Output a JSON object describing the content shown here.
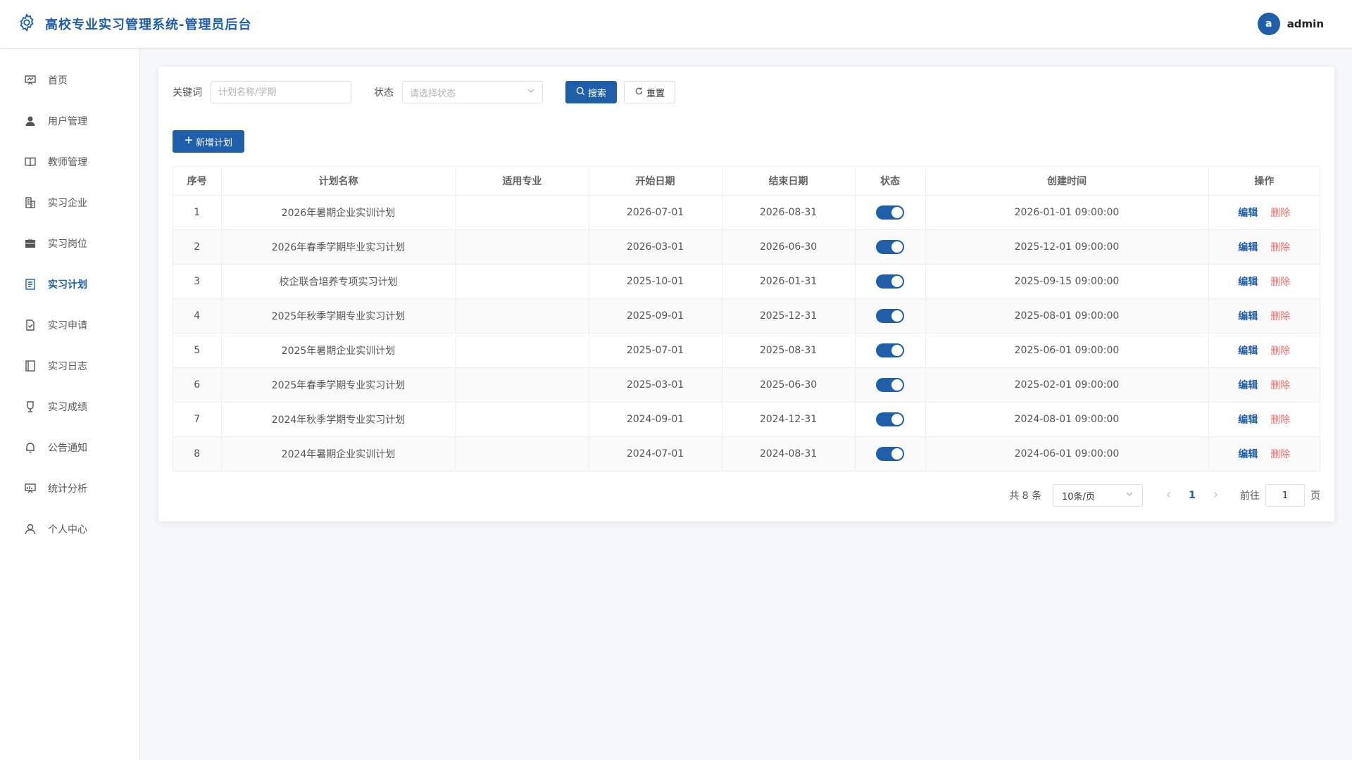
{
  "header": {
    "title": "高校专业实习管理系统-管理员后台",
    "avatar_letter": "a",
    "username": "admin"
  },
  "sidebar": {
    "items": [
      {
        "label": "首页",
        "icon": "dashboard-icon"
      },
      {
        "label": "用户管理",
        "icon": "user-icon"
      },
      {
        "label": "教师管理",
        "icon": "book-icon"
      },
      {
        "label": "实习企业",
        "icon": "building-icon"
      },
      {
        "label": "实习岗位",
        "icon": "briefcase-icon"
      },
      {
        "label": "实习计划",
        "icon": "document-icon",
        "active": true
      },
      {
        "label": "实习申请",
        "icon": "check-document-icon"
      },
      {
        "label": "实习日志",
        "icon": "notebook-icon"
      },
      {
        "label": "实习成绩",
        "icon": "trophy-icon"
      },
      {
        "label": "公告通知",
        "icon": "bell-icon"
      },
      {
        "label": "统计分析",
        "icon": "chart-board-icon"
      },
      {
        "label": "个人中心",
        "icon": "person-icon"
      }
    ]
  },
  "filters": {
    "keyword_label": "关键词",
    "keyword_placeholder": "计划名称/学期",
    "keyword_value": "",
    "status_label": "状态",
    "status_placeholder": "请选择状态",
    "search_label": "搜索",
    "reset_label": "重置"
  },
  "add_button_label": "新增计划",
  "table": {
    "columns": [
      "序号",
      "计划名称",
      "适用专业",
      "开始日期",
      "结束日期",
      "状态",
      "创建时间",
      "操作"
    ],
    "rows": [
      {
        "index": "1",
        "name": "2026年暑期企业实训计划",
        "major": "",
        "start": "2026-07-01",
        "end": "2026-08-31",
        "enabled": true,
        "created": "2026-01-01 09:00:00"
      },
      {
        "index": "2",
        "name": "2026年春季学期毕业实习计划",
        "major": "",
        "start": "2026-03-01",
        "end": "2026-06-30",
        "enabled": true,
        "created": "2025-12-01 09:00:00"
      },
      {
        "index": "3",
        "name": "校企联合培养专项实习计划",
        "major": "",
        "start": "2025-10-01",
        "end": "2026-01-31",
        "enabled": true,
        "created": "2025-09-15 09:00:00"
      },
      {
        "index": "4",
        "name": "2025年秋季学期专业实习计划",
        "major": "",
        "start": "2025-09-01",
        "end": "2025-12-31",
        "enabled": true,
        "created": "2025-08-01 09:00:00"
      },
      {
        "index": "5",
        "name": "2025年暑期企业实训计划",
        "major": "",
        "start": "2025-07-01",
        "end": "2025-08-31",
        "enabled": true,
        "created": "2025-06-01 09:00:00"
      },
      {
        "index": "6",
        "name": "2025年春季学期专业实习计划",
        "major": "",
        "start": "2025-03-01",
        "end": "2025-06-30",
        "enabled": true,
        "created": "2025-02-01 09:00:00"
      },
      {
        "index": "7",
        "name": "2024年秋季学期专业实习计划",
        "major": "",
        "start": "2024-09-01",
        "end": "2024-12-31",
        "enabled": true,
        "created": "2024-08-01 09:00:00"
      },
      {
        "index": "8",
        "name": "2024年暑期企业实训计划",
        "major": "",
        "start": "2024-07-01",
        "end": "2024-08-31",
        "enabled": true,
        "created": "2024-06-01 09:00:00"
      }
    ],
    "edit_label": "编辑",
    "delete_label": "删除"
  },
  "pagination": {
    "total_text": "共 8 条",
    "page_size": "10条/页",
    "current_page": "1",
    "goto_label": "前往",
    "goto_value": "1",
    "page_suffix": "页"
  },
  "colors": {
    "primary": "#1f5faa",
    "danger": "#f56c6c"
  }
}
